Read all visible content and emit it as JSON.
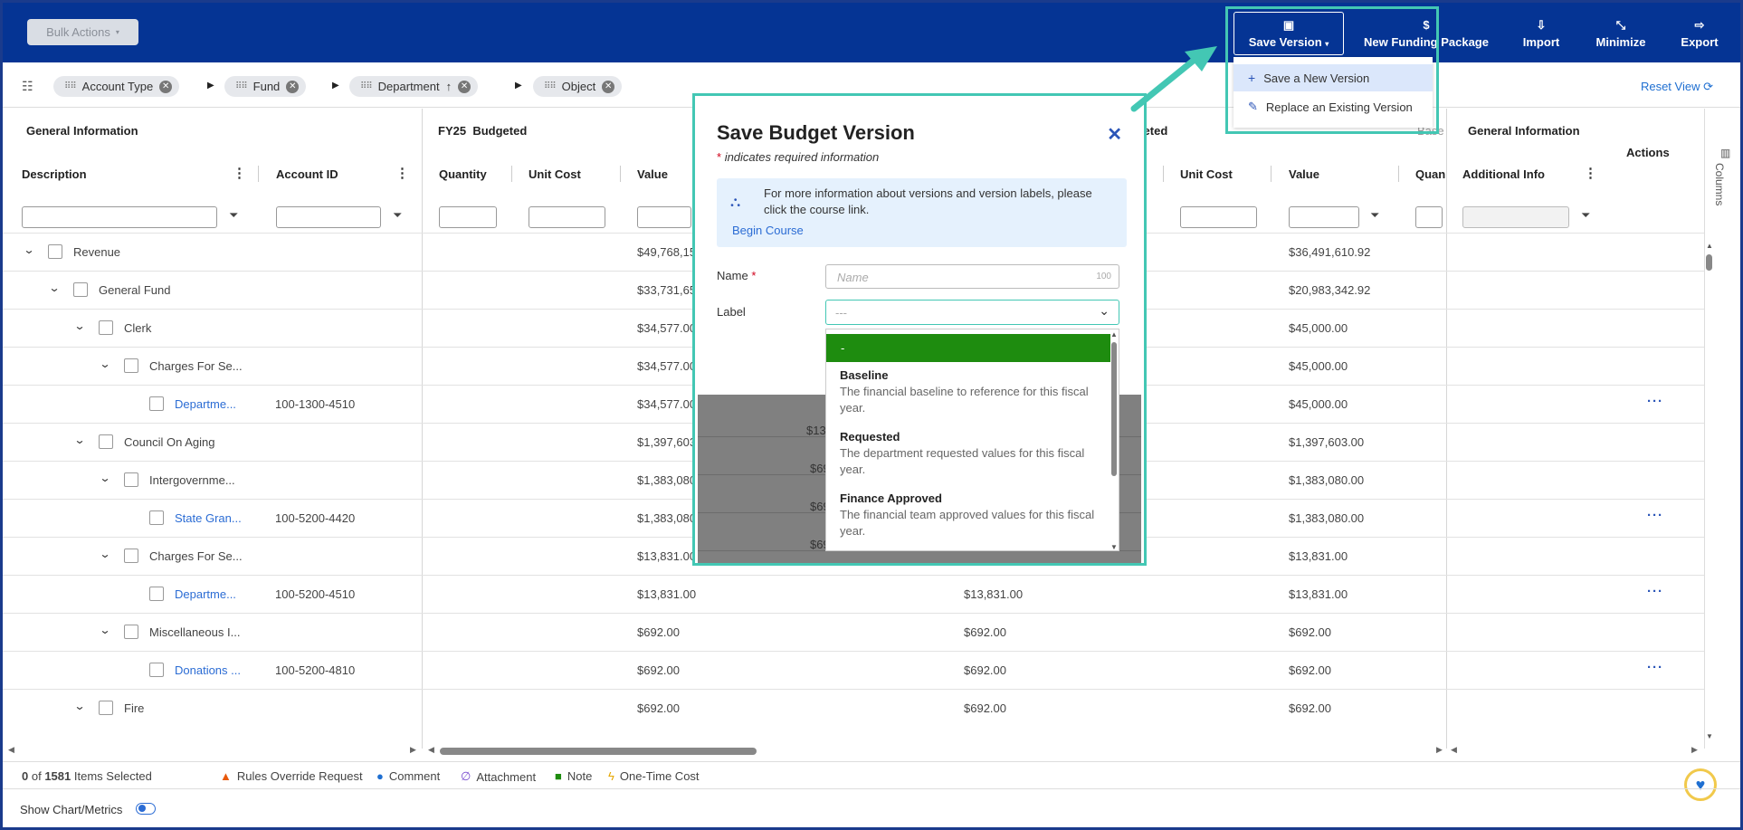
{
  "topbar": {
    "bulk_actions": "Bulk Actions",
    "save_version": "Save Version",
    "new_funding_package": "New Funding Package",
    "import": "Import",
    "minimize": "Minimize",
    "export": "Export"
  },
  "save_menu": {
    "items": [
      {
        "label": "Save a New Version",
        "icon": "plus-icon"
      },
      {
        "label": "Replace an Existing Version",
        "icon": "pencil-icon"
      }
    ]
  },
  "groupbar": {
    "chips": [
      "Account Type",
      "Fund",
      "Department",
      "Object"
    ],
    "reset_view": "Reset View"
  },
  "grid": {
    "groups": {
      "general_information": "General Information",
      "fy25": "FY25",
      "budgeted": "Budgeted",
      "budgeted_right": "lgeted",
      "general_information_right": "General Information",
      "actions": "Actions",
      "base_partial": "Base"
    },
    "columns": {
      "description": "Description",
      "account_id": "Account ID",
      "quantity": "Quantity",
      "unit_cost": "Unit Cost",
      "value": "Value",
      "unit_cost_2": "Unit Cost",
      "value_2": "Value",
      "quantity_2": "Quan",
      "additional_info": "Additional Info"
    },
    "columns_tab": "Columns",
    "rows": [
      {
        "indent": 0,
        "chevron": true,
        "label": "Revenue",
        "account": "",
        "value": "$49,768,15",
        "mid": "",
        "right": "$36,491,610.92",
        "link": false,
        "dots": false
      },
      {
        "indent": 1,
        "chevron": true,
        "label": "General Fund",
        "account": "",
        "value": "$33,731,65",
        "mid": "",
        "right": "$20,983,342.92",
        "link": false,
        "dots": false
      },
      {
        "indent": 2,
        "chevron": true,
        "label": "Clerk",
        "account": "",
        "value": "$34,577.00",
        "mid": "",
        "right": "$45,000.00",
        "link": false,
        "dots": false
      },
      {
        "indent": 3,
        "chevron": true,
        "label": "Charges For Se...",
        "account": "",
        "value": "$34,577.00",
        "mid": "",
        "right": "$45,000.00",
        "link": false,
        "dots": false
      },
      {
        "indent": 4,
        "chevron": false,
        "label": "Departme...",
        "account": "100-1300-4510",
        "value": "$34,577.00",
        "mid": "",
        "right": "$45,000.00",
        "link": true,
        "dots": true
      },
      {
        "indent": 2,
        "chevron": true,
        "label": "Council On Aging",
        "account": "",
        "value": "$1,397,603.0",
        "mid": "",
        "right": "$1,397,603.00",
        "link": false,
        "dots": false
      },
      {
        "indent": 3,
        "chevron": true,
        "label": "Intergovernme...",
        "account": "",
        "value": "$1,383,080.0",
        "mid": "",
        "right": "$1,383,080.00",
        "link": false,
        "dots": false
      },
      {
        "indent": 4,
        "chevron": false,
        "label": "State Gran...",
        "account": "100-5200-4420",
        "value": "$1,383,080.0",
        "mid": "",
        "right": "$1,383,080.00",
        "link": true,
        "dots": true
      },
      {
        "indent": 3,
        "chevron": true,
        "label": "Charges For Se...",
        "account": "",
        "value": "$13,831.00",
        "mid": "",
        "right": "$13,831.00",
        "link": false,
        "dots": false
      },
      {
        "indent": 4,
        "chevron": false,
        "label": "Departme...",
        "account": "100-5200-4510",
        "value": "$13,831.00",
        "mid": "$13,831.00",
        "right": "$13,831.00",
        "link": true,
        "dots": true
      },
      {
        "indent": 3,
        "chevron": true,
        "label": "Miscellaneous I...",
        "account": "",
        "value": "$692.00",
        "mid": "$692.00",
        "right": "$692.00",
        "link": false,
        "dots": false
      },
      {
        "indent": 4,
        "chevron": false,
        "label": "Donations ...",
        "account": "100-5200-4810",
        "value": "$692.00",
        "mid": "$692.00",
        "right": "$692.00",
        "link": true,
        "dots": true
      },
      {
        "indent": 2,
        "chevron": true,
        "label": "Fire",
        "account": "",
        "value": "$692.00",
        "mid": "$692.00",
        "right": "$692.00",
        "link": false,
        "dots": false
      }
    ]
  },
  "modal": {
    "title": "Save Budget Version",
    "required_note": "indicates required information",
    "info_text": "For more information about versions and version labels, please click the course link.",
    "info_link": "Begin Course",
    "name_label": "Name",
    "name_placeholder": "Name",
    "name_counter": "100",
    "label_label": "Label",
    "label_value": "---",
    "gray_values": [
      "$13,",
      "$69",
      "$69",
      "$69"
    ],
    "options": [
      {
        "title": "-",
        "desc": ""
      },
      {
        "title": "Baseline",
        "desc": "The financial baseline to reference for this fiscal year."
      },
      {
        "title": "Requested",
        "desc": "The department requested values for this fiscal year."
      },
      {
        "title": "Finance Approved",
        "desc": "The financial team approved values for this fiscal year."
      }
    ]
  },
  "footer": {
    "selected_count": "0",
    "selected_of": "of",
    "total": "1581",
    "selected_suffix": "Items Selected",
    "legend": [
      {
        "label": "Rules Override Request",
        "icon": "warning-icon",
        "color": "#e8590c"
      },
      {
        "label": "Comment",
        "icon": "comment-icon",
        "color": "#1f6fd1"
      },
      {
        "label": "Attachment",
        "icon": "paperclip-icon",
        "color": "#7b4fd0"
      },
      {
        "label": "Note",
        "icon": "note-icon",
        "color": "#1e8c0f"
      },
      {
        "label": "One-Time Cost",
        "icon": "lightning-icon",
        "color": "#e6a700"
      }
    ],
    "show_chart": "Show Chart/Metrics"
  },
  "colors": {
    "topbar": "#053494",
    "highlight": "#43c7b4",
    "selected_option": "#1e8c0f",
    "link": "#2b6cd4"
  }
}
